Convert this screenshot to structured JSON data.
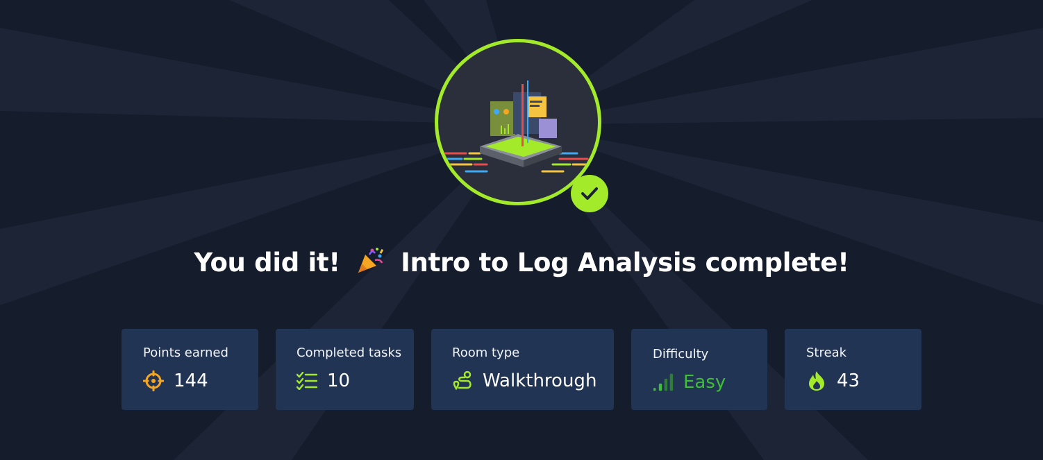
{
  "completion": {
    "prefix": "You did it!",
    "room_name": "Intro to Log Analysis",
    "suffix": "complete!",
    "party_icon": "party-popper-icon",
    "badge_icon": "log-analysis-room-badge",
    "check_icon": "checkmark-icon"
  },
  "stats": [
    {
      "label": "Points earned",
      "value": "144",
      "icon": "target-crosshair-icon",
      "icon_color": "#f5a623"
    },
    {
      "label": "Completed tasks",
      "value": "10",
      "icon": "checklist-icon",
      "icon_color": "#a3ea2a"
    },
    {
      "label": "Room type",
      "value": "Walkthrough",
      "icon": "route-path-icon",
      "icon_color": "#a3ea2a"
    },
    {
      "label": "Difficulty",
      "value": "Easy",
      "icon": "signal-bars-icon",
      "icon_color": "#3fbe3a"
    },
    {
      "label": "Streak",
      "value": "43",
      "icon": "flame-icon",
      "icon_color": "#a3ea2a"
    }
  ],
  "colors": {
    "background": "#151c2b",
    "card": "#223453",
    "accent": "#a3ea2a",
    "easy": "#3fbe3a"
  }
}
